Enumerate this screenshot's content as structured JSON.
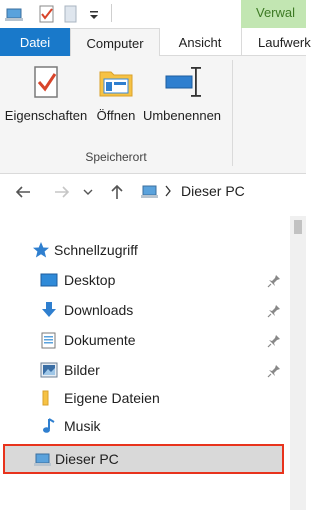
{
  "ribbon": {
    "context_tab": "Verwal",
    "tabs": [
      {
        "label": "Datei"
      },
      {
        "label": "Computer"
      },
      {
        "label": "Ansicht"
      },
      {
        "label": "Laufwerk"
      }
    ],
    "buttons": [
      {
        "label": "Eigenschaften",
        "icon": "properties-icon"
      },
      {
        "label": "Öffnen",
        "icon": "open-icon"
      },
      {
        "label": "Umbenennen",
        "icon": "rename-icon"
      }
    ],
    "group_label": "Speicherort"
  },
  "address": {
    "path": "Dieser PC"
  },
  "navigation": {
    "quick_access": "Schnellzugriff",
    "items": [
      {
        "label": "Desktop",
        "pinned": true
      },
      {
        "label": "Downloads",
        "pinned": true
      },
      {
        "label": "Dokumente",
        "pinned": true
      },
      {
        "label": "Bilder",
        "pinned": true
      },
      {
        "label": "Eigene Dateien",
        "pinned": false
      },
      {
        "label": "Musik",
        "pinned": false
      }
    ],
    "this_pc": "Dieser PC"
  },
  "colors": {
    "accent": "#1979ca",
    "highlight_border": "#e8331c",
    "context_tab": "#c2e6b2"
  }
}
